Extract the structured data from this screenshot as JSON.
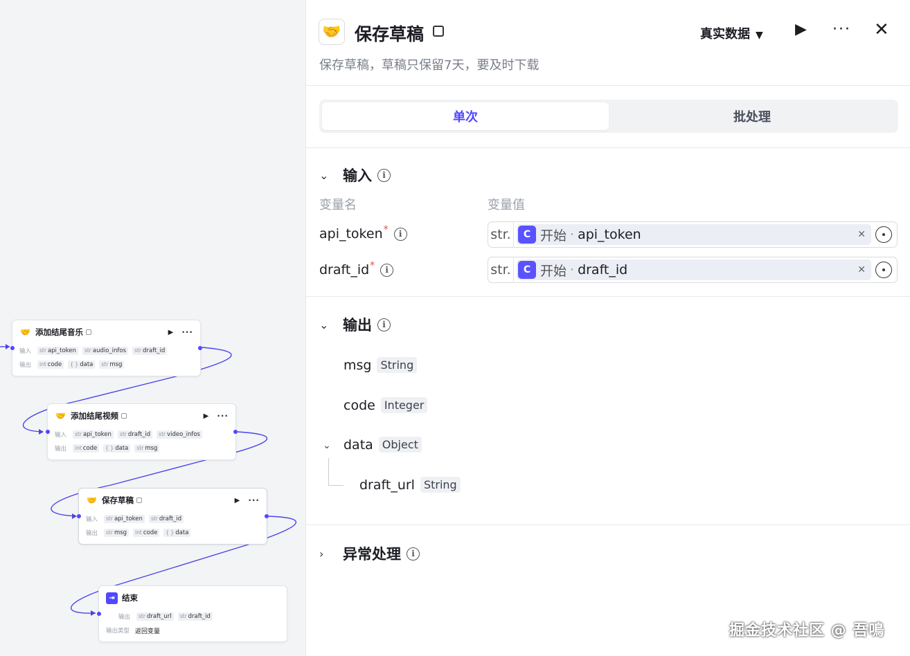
{
  "canvas": {
    "nodes": [
      {
        "title": "添加结尾音乐",
        "inputs": [
          [
            "str",
            "api_token"
          ],
          [
            "str",
            "audio_infos"
          ],
          [
            "str",
            "draft_id"
          ]
        ],
        "outputs": [
          [
            "int",
            "code"
          ],
          [
            "{ }",
            "data"
          ],
          [
            "str",
            "msg"
          ]
        ]
      },
      {
        "title": "添加结尾视频",
        "inputs": [
          [
            "str",
            "api_token"
          ],
          [
            "str",
            "draft_id"
          ],
          [
            "str",
            "video_infos"
          ]
        ],
        "outputs": [
          [
            "int",
            "code"
          ],
          [
            "{ }",
            "data"
          ],
          [
            "str",
            "msg"
          ]
        ]
      },
      {
        "title": "保存草稿",
        "inputs": [
          [
            "str",
            "api_token"
          ],
          [
            "str",
            "draft_id"
          ]
        ],
        "outputs": [
          [
            "str",
            "msg"
          ],
          [
            "int",
            "code"
          ],
          [
            "{ }",
            "data"
          ]
        ]
      }
    ],
    "labels": {
      "input": "输入",
      "output": "输出",
      "output_type": "输出类型"
    },
    "end_node": {
      "title": "结束",
      "outputs": [
        [
          "str",
          "draft_url"
        ],
        [
          "str",
          "draft_id"
        ]
      ],
      "output_type_value": "返回变量"
    },
    "accent": "#5147ff"
  },
  "panel": {
    "title": "保存草稿",
    "description": "保存草稿，草稿只保留7天，要及时下载",
    "data_mode": "真实数据",
    "tabs": [
      {
        "label": "单次",
        "active": true
      },
      {
        "label": "批处理",
        "active": false
      }
    ],
    "input_section": {
      "title": "输入",
      "col_name": "变量名",
      "col_value": "变量值",
      "rows": [
        {
          "name": "api_token",
          "required": "*",
          "type": "str.",
          "source": "开始",
          "value": "api_token"
        },
        {
          "name": "draft_id",
          "required": "*",
          "type": "str.",
          "source": "开始",
          "value": "draft_id"
        }
      ]
    },
    "output_section": {
      "title": "输出",
      "items": [
        {
          "name": "msg",
          "type": "String"
        },
        {
          "name": "code",
          "type": "Integer"
        },
        {
          "name": "data",
          "type": "Object"
        },
        {
          "name": "draft_url",
          "type": "String"
        }
      ]
    },
    "error_section": {
      "title": "异常处理"
    }
  },
  "watermark": "掘金技术社区 @ 吾鳴"
}
